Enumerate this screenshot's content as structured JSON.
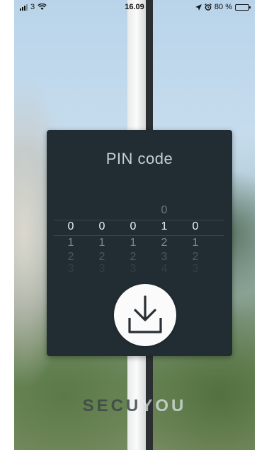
{
  "status_bar": {
    "carrier": "3",
    "time": "16.09",
    "battery": "80 %",
    "battery_level": 0.8,
    "icons": [
      "signal-icon",
      "wifi-icon",
      "location-arrow-icon",
      "alarm-icon",
      "battery-icon"
    ]
  },
  "modal": {
    "title": "PIN code"
  },
  "pin": {
    "wheels": [
      {
        "above": "",
        "selected": "0",
        "next": "1",
        "next2": "2",
        "next3": "3"
      },
      {
        "above": "",
        "selected": "0",
        "next": "1",
        "next2": "2",
        "next3": "3"
      },
      {
        "above": "",
        "selected": "0",
        "next": "1",
        "next2": "2",
        "next3": "3"
      },
      {
        "above": "0",
        "selected": "1",
        "next": "2",
        "next2": "3",
        "next3": "4"
      },
      {
        "above": "",
        "selected": "0",
        "next": "1",
        "next2": "2",
        "next3": "3"
      }
    ]
  },
  "actions": {
    "download_icon": "download-icon"
  },
  "brand": {
    "part1": "SECU",
    "part2": "YOU"
  },
  "colors": {
    "modal_bg": "#222d33",
    "button_bg": "#fbfbfb"
  }
}
